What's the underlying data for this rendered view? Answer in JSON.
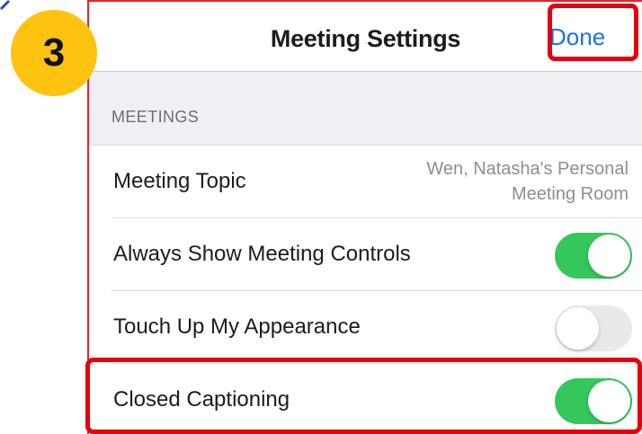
{
  "header": {
    "title": "Meeting Settings",
    "done_label": "Done"
  },
  "step_badge": "3",
  "section": {
    "title": "MEETINGS"
  },
  "rows": [
    {
      "label": "Meeting Topic",
      "value_line1": "Wen, Natasha's Personal",
      "value_line2": "Meeting Room"
    },
    {
      "label": "Always Show Meeting Controls",
      "toggle": "on"
    },
    {
      "label": "Touch Up My Appearance",
      "toggle": "off"
    },
    {
      "label": "Closed Captioning",
      "toggle": "on"
    }
  ],
  "colors": {
    "accent_blue": "#1a73e8",
    "toggle_on": "#34c759",
    "toggle_off": "#e9e9eb",
    "highlight_red": "#e3000f",
    "badge_yellow": "#fdc310"
  }
}
